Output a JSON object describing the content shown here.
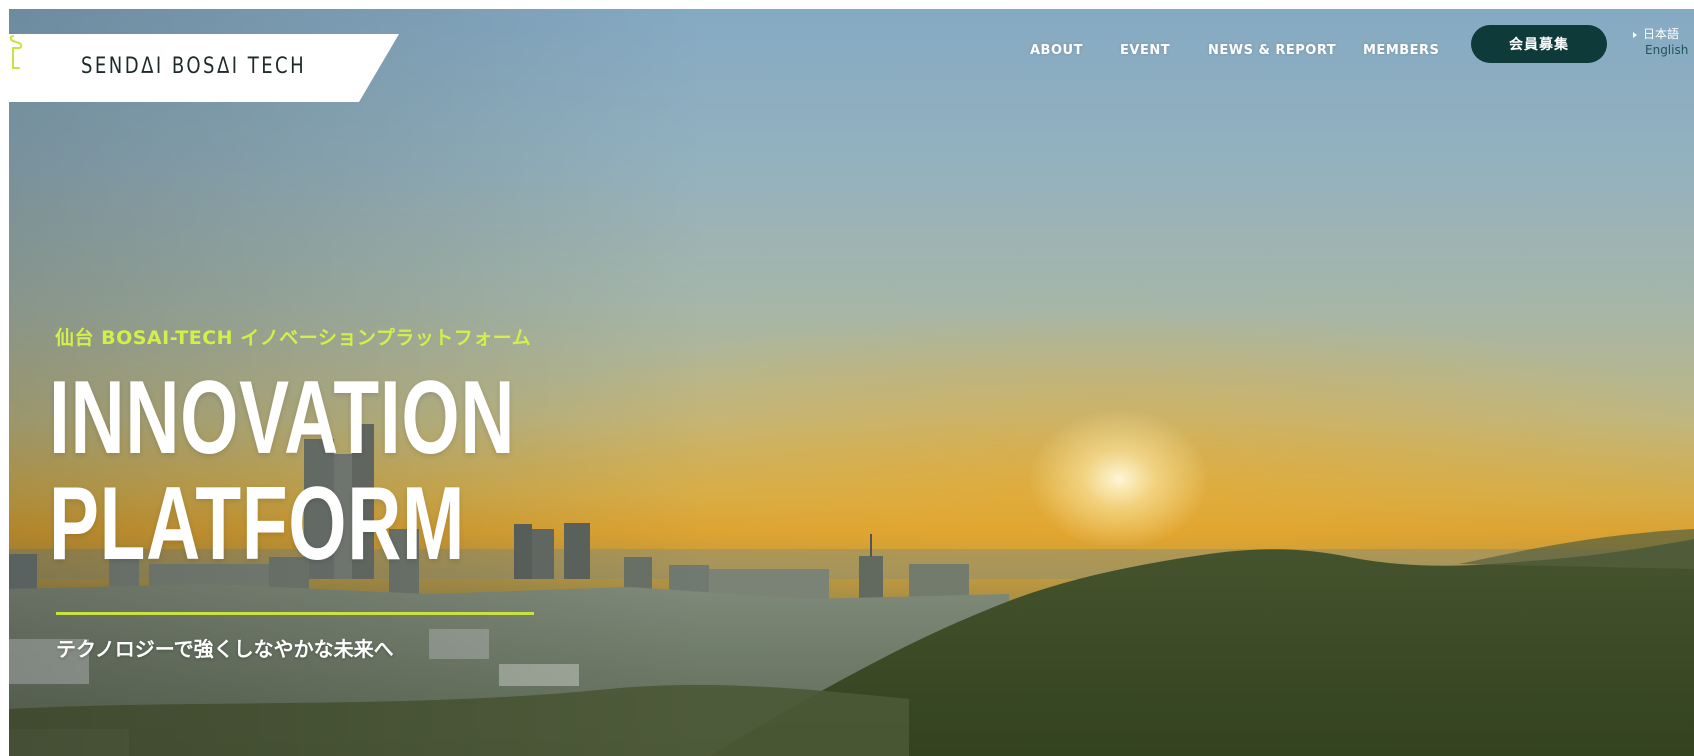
{
  "brand": {
    "logo_text": "SENDΔI BOSΔI TECH"
  },
  "nav": {
    "items": [
      {
        "label": "ABOUT"
      },
      {
        "label": "EVENT"
      },
      {
        "label": "NEWS & REPORT"
      },
      {
        "label": "MEMBERS"
      }
    ],
    "cta_label": "会員募集"
  },
  "language": {
    "current": "日本語",
    "alternate": "English"
  },
  "hero": {
    "eyebrow": "仙台 BOSAI-TECH イノベーションプラットフォーム",
    "headline_line1": "INNOVATION",
    "headline_line2": "PLATFORM",
    "tagline": "テクノロジーで強くしなやかな未来へ"
  },
  "colors": {
    "cta_background": "#0e3a3a",
    "accent_lime": "#c8e33f",
    "eyebrow_text": "#d4ef4a",
    "english_link": "#1f5555"
  }
}
